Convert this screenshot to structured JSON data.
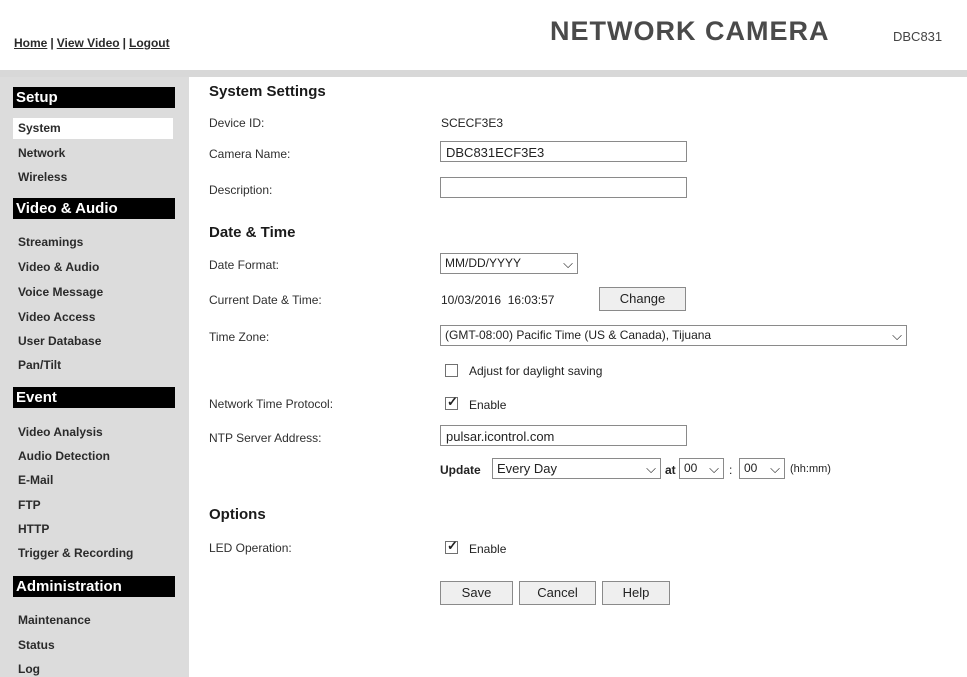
{
  "header": {
    "links": [
      "Home",
      "View Video",
      "Logout"
    ],
    "brand": "NETWORK CAMERA",
    "model": "DBC831"
  },
  "sidebar": {
    "sections": [
      {
        "title": "Setup",
        "items": [
          "System",
          "Network",
          "Wireless"
        ]
      },
      {
        "title": "Video & Audio",
        "items": [
          "Streamings",
          "Video & Audio",
          "Voice Message",
          "Video Access",
          "User Database",
          "Pan/Tilt"
        ]
      },
      {
        "title": "Event",
        "items": [
          "Video Analysis",
          "Audio Detection",
          "E-Mail",
          "FTP",
          "HTTP",
          "Trigger & Recording"
        ]
      },
      {
        "title": "Administration",
        "items": [
          "Maintenance",
          "Status",
          "Log"
        ]
      }
    ],
    "active_item": "System"
  },
  "main": {
    "system_settings": {
      "heading": "System Settings",
      "device_id_label": "Device ID:",
      "device_id_value": "SCECF3E3",
      "camera_name_label": "Camera Name:",
      "camera_name_value": "DBC831ECF3E3",
      "description_label": "Description:",
      "description_value": ""
    },
    "date_time": {
      "heading": "Date & Time",
      "date_format_label": "Date Format:",
      "date_format_value": "MM/DD/YYYY",
      "current_label": "Current Date & Time:",
      "current_value": "10/03/2016  16:03:57",
      "change_button": "Change",
      "timezone_label": "Time Zone:",
      "timezone_value": "(GMT-08:00) Pacific Time (US & Canada), Tijuana",
      "daylight_label": "Adjust for daylight saving",
      "daylight_checked": false,
      "ntp_label": "Network Time Protocol:",
      "ntp_enable_label": "Enable",
      "ntp_checked": true,
      "ntp_server_label": "NTP Server Address:",
      "ntp_server_value": "pulsar.icontrol.com",
      "update_label": "Update",
      "update_value": "Every Day",
      "at_label": "at",
      "hour_value": "00",
      "colon": ":",
      "minute_value": "00",
      "hhmm_label": "(hh:mm)"
    },
    "options": {
      "heading": "Options",
      "led_label": "LED Operation:",
      "led_enable_label": "Enable",
      "led_checked": true
    },
    "buttons": {
      "save": "Save",
      "cancel": "Cancel",
      "help": "Help"
    }
  }
}
